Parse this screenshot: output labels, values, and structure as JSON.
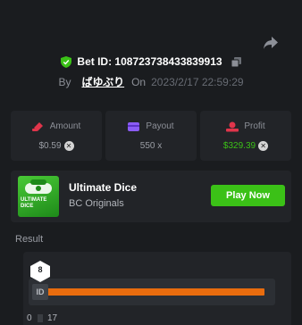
{
  "bet": {
    "id_label": "Bet ID: 108723738433839913",
    "by_label": "By",
    "user": "ばゆぶり",
    "on_label": "On",
    "date": "2023/2/17 22:59:29"
  },
  "stats": [
    {
      "label": "Amount",
      "value": "$0.59",
      "icon": "wallet-icon",
      "color": "#e0354b"
    },
    {
      "label": "Payout",
      "value": "550 x",
      "icon": "card-icon",
      "color": "#8b5cf6"
    },
    {
      "label": "Profit",
      "value": "$329.39",
      "icon": "money-icon",
      "color": "#e0354b"
    }
  ],
  "game": {
    "thumb_text": "ULTIMATE DICE",
    "title": "Ultimate Dice",
    "provider": "BC Originals",
    "play_label": "Play Now"
  },
  "result": {
    "label": "Result",
    "value": "8",
    "handle_text": "ID",
    "min": "0",
    "max": "17",
    "fill_fraction": 0.955
  },
  "colors": {
    "accent_green": "#3bc117",
    "bar_orange": "#e96c0e",
    "background": "#1a1c1f",
    "panel": "#222428"
  }
}
